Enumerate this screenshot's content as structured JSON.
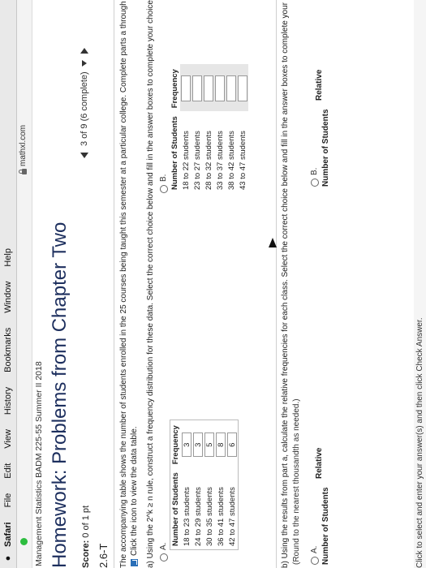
{
  "menubar": {
    "app": "Safari",
    "items": [
      "File",
      "Edit",
      "View",
      "History",
      "Bookmarks",
      "Window",
      "Help"
    ]
  },
  "browser": {
    "url": "mathxl.com"
  },
  "course": "Management Statistics BADM 225-55 Summer II 2018",
  "page_title": "Homework: Problems from Chapter Two",
  "score": {
    "label": "Score:",
    "value": "0 of 1 pt"
  },
  "nav": {
    "progress": "3 of 9 (6 complete)"
  },
  "question_id": "2.6-T",
  "intro": {
    "line1": "The accompanying table shows the number of students enrolled in the 25 courses being taught this semester at a particular college. Complete parts a through d bel",
    "line2": "Click the icon to view the data table."
  },
  "part_a": "a) Using the 2^k ≥ n rule, construct a frequency distribution for these data. Select the correct choice below and fill in the answer boxes to complete your choice.",
  "option_a": {
    "label": "A.",
    "headers": [
      "Number of Students",
      "Frequency"
    ],
    "rows": [
      [
        "18 to 23 students",
        "3"
      ],
      [
        "24 to 29 students",
        "3"
      ],
      [
        "30 to 35 students",
        "5"
      ],
      [
        "36 to 41 students",
        "8"
      ],
      [
        "42 to 47 students",
        "6"
      ]
    ]
  },
  "option_b": {
    "label": "B.",
    "headers": [
      "Number of Students",
      "Frequency"
    ],
    "rows": [
      [
        "18 to 22 students",
        ""
      ],
      [
        "23 to 27 students",
        ""
      ],
      [
        "28 to 32 students",
        ""
      ],
      [
        "33 to 37 students",
        ""
      ],
      [
        "38 to 42 students",
        ""
      ],
      [
        "43 to 47 students",
        ""
      ]
    ]
  },
  "part_b": "b) Using the results from part a, calculate the relative frequencies for each class. Select the correct choice below and fill in the answer boxes to complete your choic",
  "round_note": "(Round to the nearest thousandth as needed.)",
  "part_b_options": {
    "a_label": "A.",
    "b_label": "B.",
    "col1": "Number of Students",
    "col2": "Relative"
  },
  "footer": "Click to select and enter your answer(s) and then click Check Answer.",
  "colors": {
    "title": "#1d2f5e",
    "icon": "#2a6fb8",
    "status_dot": "#2dbd3f"
  }
}
